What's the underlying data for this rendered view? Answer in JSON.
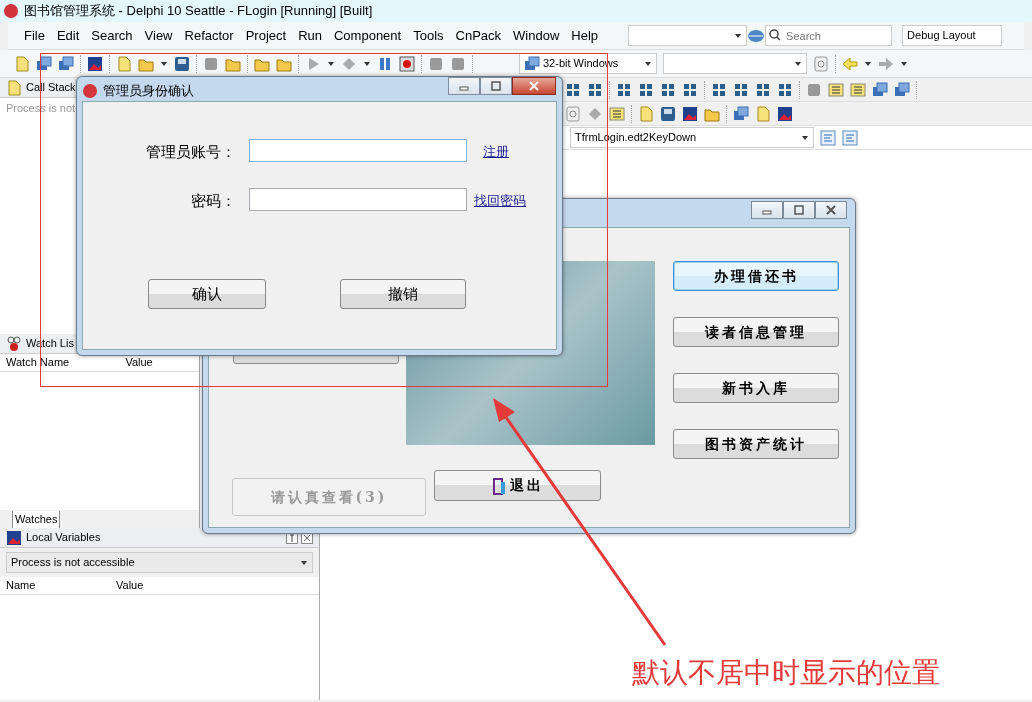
{
  "window": {
    "title": "图书馆管理系统 - Delphi 10 Seattle - FLogin [Running] [Built]"
  },
  "menu": [
    {
      "label": "File"
    },
    {
      "label": "Edit"
    },
    {
      "label": "Search"
    },
    {
      "label": "View"
    },
    {
      "label": "Refactor"
    },
    {
      "label": "Project"
    },
    {
      "label": "Run"
    },
    {
      "label": "Component"
    },
    {
      "label": "Tools"
    },
    {
      "label": "CnPack"
    },
    {
      "label": "Window"
    },
    {
      "label": "Help"
    }
  ],
  "ide_search": {
    "placeholder": "Search"
  },
  "desktop_layout": "Debug Layout",
  "platform": "32-bit Windows",
  "call_stack": {
    "title": "Call Stack",
    "message": "Process is not"
  },
  "watch_list": {
    "title": "Watch Lis",
    "columns": [
      "Watch Name",
      "Value"
    ],
    "tabs": [
      {
        "label": "Watches",
        "selected": true
      }
    ]
  },
  "local_variables": {
    "title": "Local Variables",
    "process": "Process is not accessible",
    "columns": [
      "Name",
      "Value"
    ]
  },
  "method_selector": "TfrmLogin.edt2KeyDown",
  "main_form": {
    "side_buttons": [
      {
        "label": "办理借还书",
        "focused": true
      },
      {
        "label": "读者信息管理",
        "focused": false
      },
      {
        "label": "新书入库",
        "focused": false
      },
      {
        "label": "图书资产统计",
        "focused": false
      }
    ],
    "bottom_buttons": [
      {
        "label": "请认真查看(3)",
        "disabled": true,
        "kind": "plain"
      },
      {
        "label": "退出",
        "disabled": false,
        "kind": "exit"
      }
    ]
  },
  "login_dialog": {
    "title": "管理员身份确认",
    "fields": [
      {
        "label": "管理员账号：",
        "link": "注册",
        "focused": true
      },
      {
        "label": "密码：",
        "link": "找回密码",
        "focused": false
      }
    ],
    "buttons": [
      {
        "label": "确认"
      },
      {
        "label": "撤销"
      }
    ]
  },
  "annotation": "默认不居中时显示的位置"
}
